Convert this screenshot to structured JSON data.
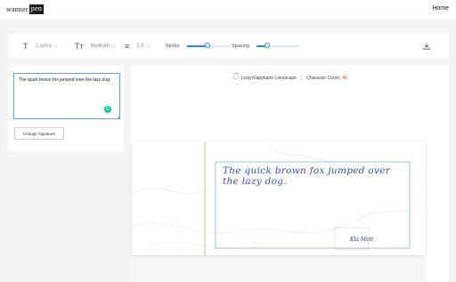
{
  "header": {
    "logo_text": "wanner",
    "logo_box": "pen",
    "home_label": "Home"
  },
  "toolbar": {
    "font_icon": "T",
    "font_value": "1 anna",
    "size_icon": "Tт",
    "size_value": "Medium",
    "line_icon": "≡",
    "line_value": "2.5",
    "stroke_label": "Stroke",
    "stroke_level": 0.48,
    "spacing_label": "Spacing",
    "spacing_level": 0.25,
    "download_icon": "download-icon"
  },
  "editor": {
    "text_value": "The quick brown fox jumped over the lazy dog.",
    "change_signature_label": "Change Signature"
  },
  "paper_info": {
    "paper_name": "Long Klappkarte Landscape",
    "character_count_label": "Character Count:",
    "character_count_value": "46"
  },
  "preview": {
    "handwritten_text": "The quick brown fox jumped over the lazy dog.",
    "signature": "Kla Mett"
  },
  "colors": {
    "accent": "#2b8ad8",
    "handwriting": "#3a4fb0",
    "count_red": "#e0403a"
  }
}
